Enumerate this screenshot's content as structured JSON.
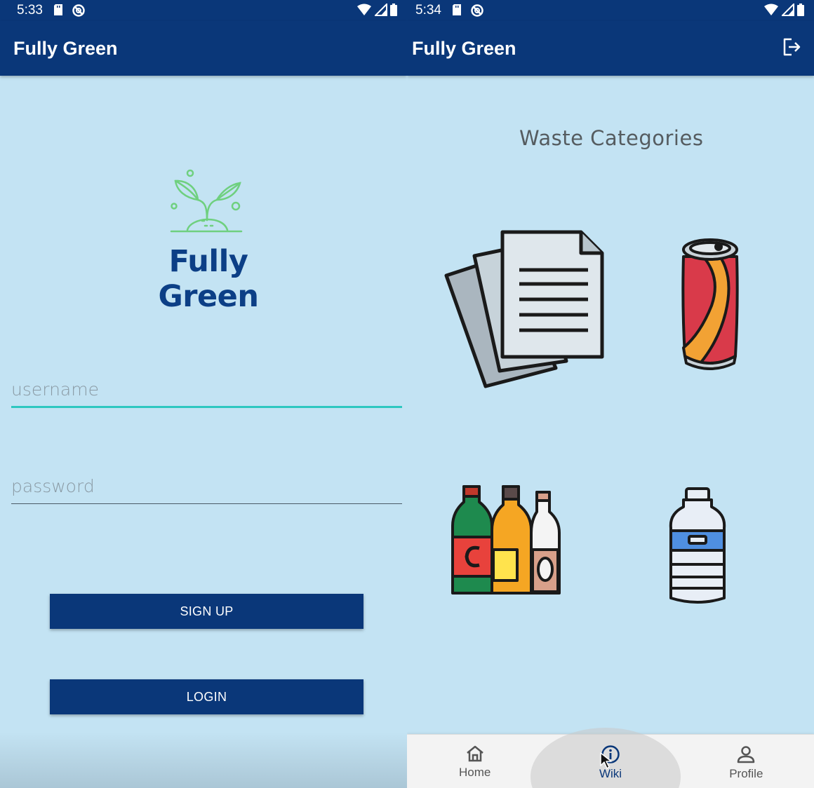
{
  "left": {
    "status": {
      "time": "5:33"
    },
    "appbar": {
      "title": "Fully Green"
    },
    "logo": {
      "text": "Fully Green"
    },
    "form": {
      "username_placeholder": "username",
      "password_placeholder": "password",
      "signup_label": "SIGN UP",
      "login_label": "LOGIN"
    }
  },
  "right": {
    "status": {
      "time": "5:34"
    },
    "appbar": {
      "title": "Fully Green"
    },
    "section_title": "Waste Categories",
    "categories": [
      {
        "icon": "paper-icon"
      },
      {
        "icon": "can-icon"
      },
      {
        "icon": "glass-bottles-icon"
      },
      {
        "icon": "plastic-bottle-icon"
      }
    ],
    "nav": [
      {
        "label": "Home",
        "icon": "home-icon"
      },
      {
        "label": "Wiki",
        "icon": "info-icon",
        "active": true
      },
      {
        "label": "Profile",
        "icon": "person-icon"
      }
    ]
  },
  "colors": {
    "primary": "#0a3779",
    "background": "#c3e3f3",
    "accent": "#2ec7c0",
    "logo_green": "#6fd07f"
  }
}
